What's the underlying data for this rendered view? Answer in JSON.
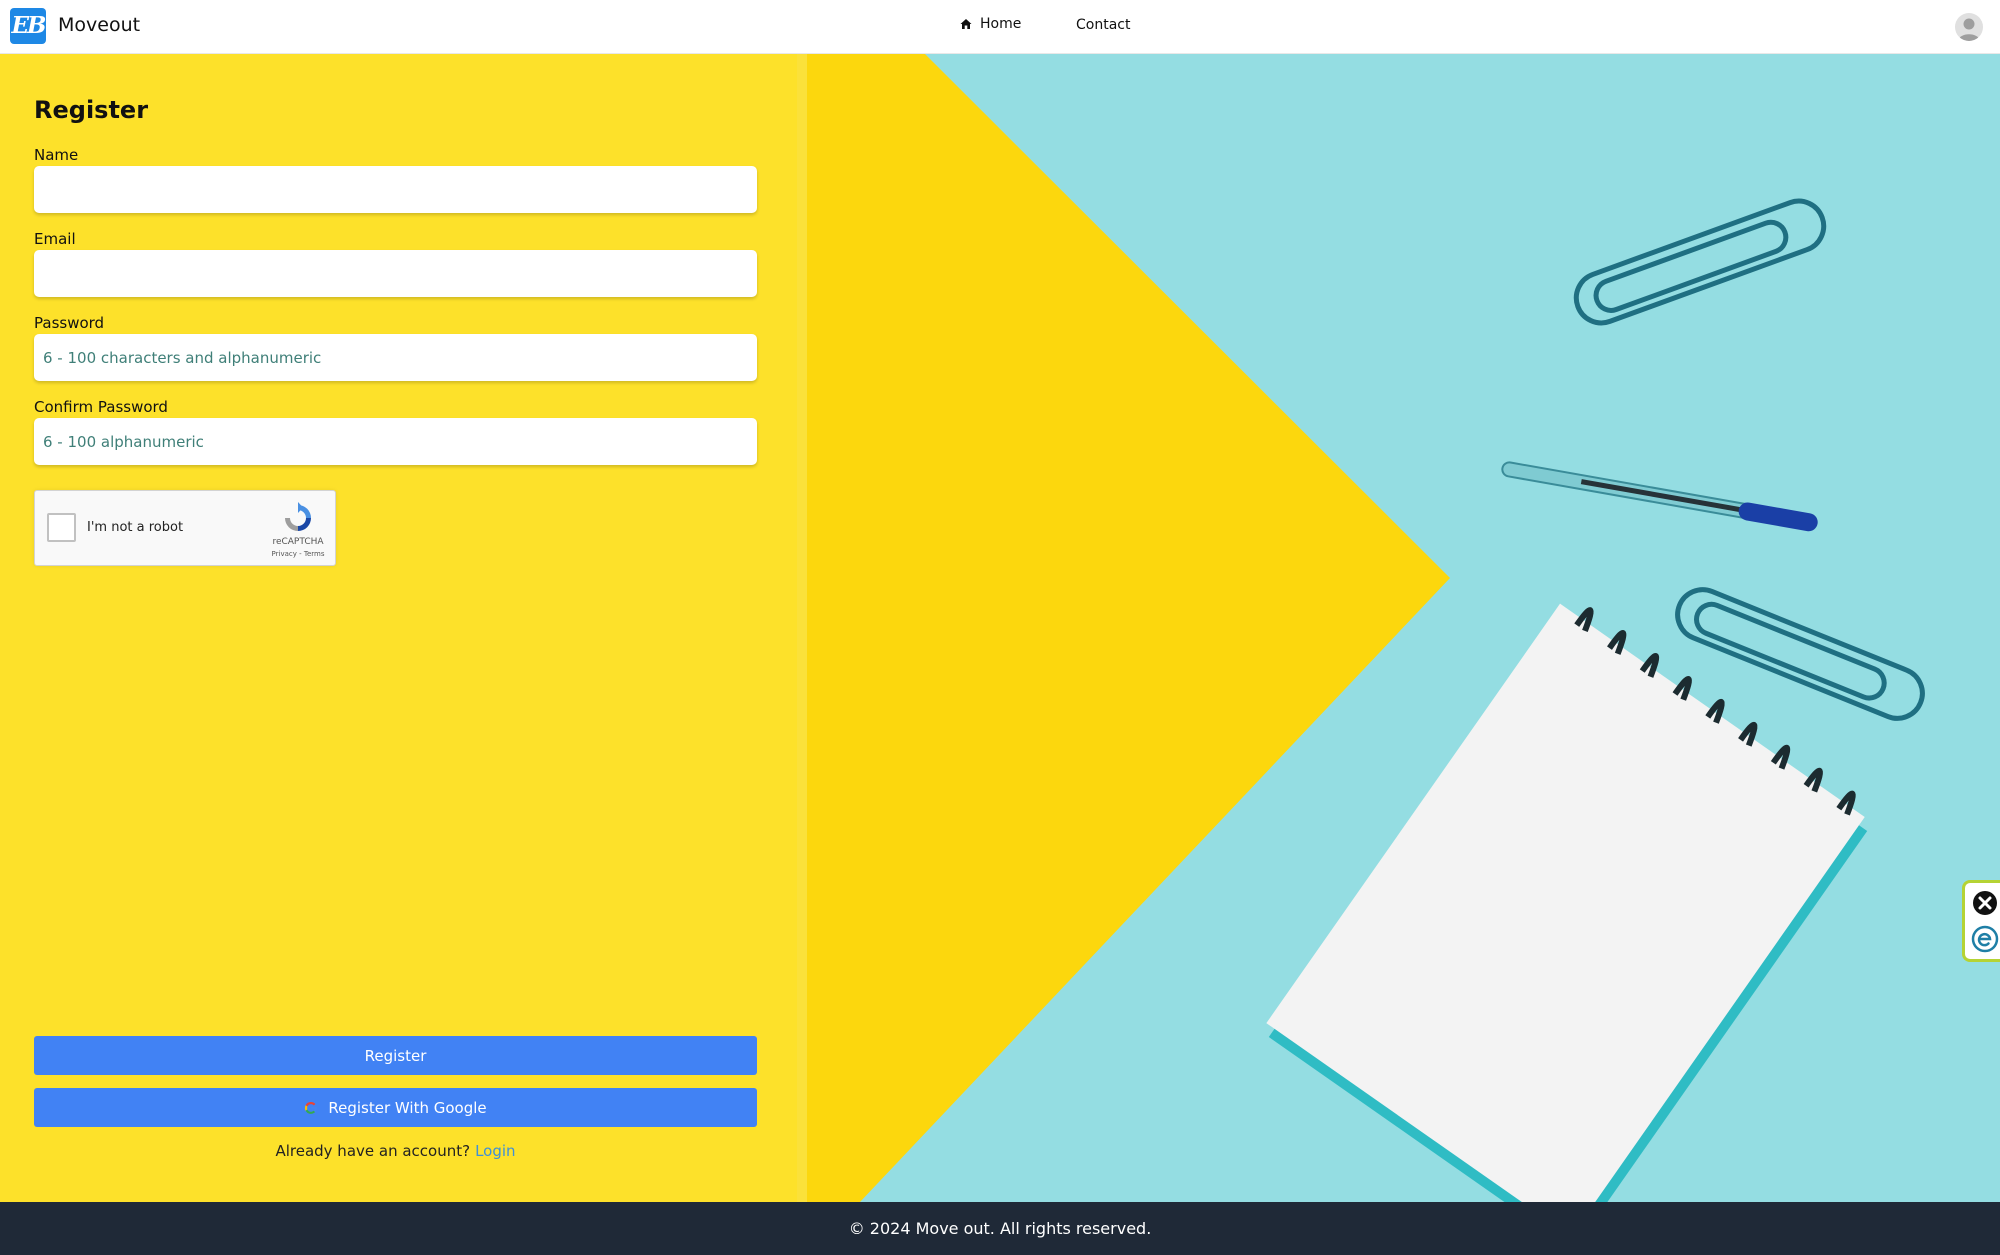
{
  "header": {
    "logo_text": "EB",
    "brand": "Moveout",
    "nav": {
      "home": "Home",
      "contact": "Contact"
    }
  },
  "form": {
    "title": "Register",
    "name": {
      "label": "Name",
      "value": "",
      "placeholder": ""
    },
    "email": {
      "label": "Email",
      "value": "",
      "placeholder": ""
    },
    "password": {
      "label": "Password",
      "value": "",
      "placeholder": "6 - 100 characters and alphanumeric"
    },
    "confirm_password": {
      "label": "Confirm Password",
      "value": "",
      "placeholder": "6 - 100 alphanumeric"
    },
    "captcha": {
      "label": "I'm not a robot",
      "brand": "reCAPTCHA",
      "terms": "Privacy - Terms"
    },
    "register_button": "Register",
    "google_button": "Register With Google",
    "login_prompt": "Already have an account?",
    "login_link": "Login"
  },
  "footer": {
    "text": "© 2024 Move out. All rights reserved."
  },
  "colors": {
    "brand_blue": "#1e88e5",
    "form_yellow": "#fde12a",
    "button_blue": "#4182f4",
    "link_blue": "#3f90d8",
    "footer_dark": "#1f2937",
    "photo_cyan": "#94dde2",
    "widget_green": "#b5d334"
  },
  "icons": {
    "home": "home-icon",
    "avatar": "user-avatar-icon",
    "captcha": "recaptcha-logo-icon",
    "google": "google-g-icon",
    "widget_close": "close-circle-icon",
    "widget_app": "e-logo-icon"
  }
}
